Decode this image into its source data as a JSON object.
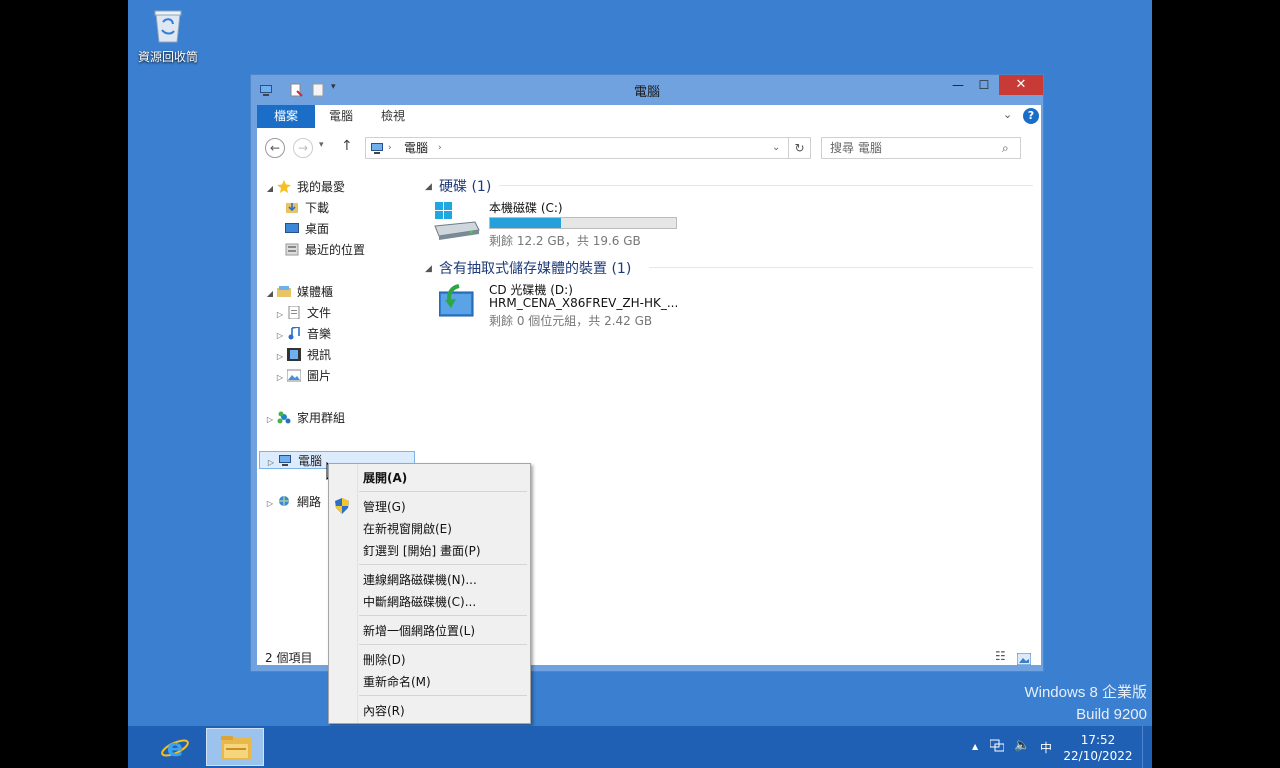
{
  "desktop": {
    "recycle_bin_label": "資源回收筒",
    "watermark_line1": "Windows 8 企業版",
    "watermark_line2": "Build 9200"
  },
  "window": {
    "title": "電腦",
    "controls": {
      "minimize": "—",
      "maximize": "☐",
      "close": "✕"
    },
    "ribbon_tabs": [
      "檔案",
      "電腦",
      "檢視"
    ],
    "address": {
      "path": "電腦",
      "separator": "›"
    },
    "search": {
      "placeholder": "搜尋 電腦"
    },
    "nav": {
      "favorites": {
        "label": "我的最愛",
        "items": [
          "下載",
          "桌面",
          "最近的位置"
        ]
      },
      "libraries": {
        "label": "媒體櫃",
        "items": [
          "文件",
          "音樂",
          "視訊",
          "圖片"
        ]
      },
      "homegroup": "家用群組",
      "computer": "電腦",
      "network": "網路"
    },
    "groups": [
      {
        "header": "硬碟 (1)"
      },
      {
        "header": "含有抽取式儲存媒體的裝置 (1)"
      }
    ],
    "drives": {
      "c": {
        "name": "本機磁碟 (C:)",
        "free_text": "剩餘 12.2 GB，共 19.6 GB",
        "used_fraction": 0.38
      },
      "d": {
        "name": "CD 光碟機 (D:)",
        "label": "HRM_CENA_X86FREV_ZH-HK_...",
        "free_text": "剩餘 0 個位元組，共 2.42 GB"
      }
    },
    "status": "2 個項目"
  },
  "context_menu": {
    "expand": "展開(A)",
    "manage": "管理(G)",
    "open_new_window": "在新視窗開啟(E)",
    "pin_start": "釘選到 [開始] 畫面(P)",
    "map_drive": "連線網路磁碟機(N)...",
    "disconnect_drive": "中斷網路磁碟機(C)...",
    "add_network_location": "新增一個網路位置(L)",
    "delete": "刪除(D)",
    "rename": "重新命名(M)",
    "properties": "內容(R)"
  },
  "taskbar": {
    "ime": "中",
    "time": "17:52",
    "date": "22/10/2022"
  },
  "colors": {
    "desktop": "#3a7fd0",
    "taskbar": "#1f5fb4",
    "close": "#c73a35",
    "accent": "#1a6ec8"
  }
}
